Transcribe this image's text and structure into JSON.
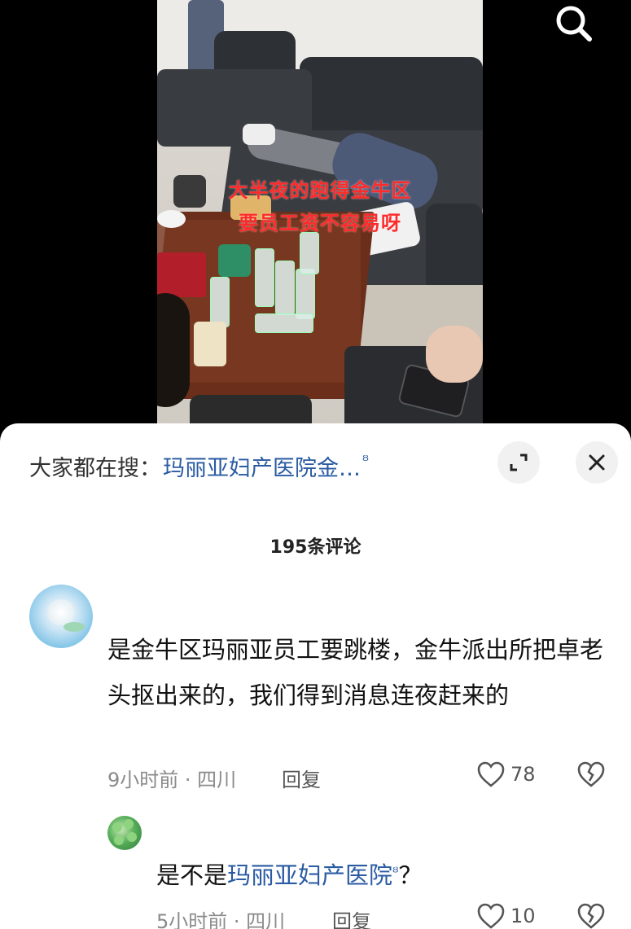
{
  "video": {
    "overlay_line1": "大半夜的跑得金牛区",
    "overlay_line2": "要员工资不容易呀"
  },
  "icons": {
    "search": "search-icon",
    "expand": "expand-icon",
    "close": "close-icon",
    "heart": "heart-icon",
    "dislike": "broken-heart-icon"
  },
  "colors": {
    "link": "#2a5ba3",
    "overlay_text": "#ff2a2a"
  },
  "search_bar": {
    "label": "大家都在搜：",
    "keyword": "玛丽亚妇产医院金…",
    "keyword_icon": "ᴽ"
  },
  "comments_header": {
    "count_label": "195条评论"
  },
  "comments": [
    {
      "text": "是金牛区玛丽亚员工要跳楼，金牛派出所把卓老头抠出来的，我们得到消息连夜赶来的",
      "meta": "9小时前 · 四川",
      "reply_label": "回复",
      "likes": "78"
    },
    {
      "text_prefix": "是不是",
      "text_keyword": "玛丽亚妇产医院",
      "text_suffix": "？",
      "meta": "5小时前 · 四川",
      "reply_label": "回复",
      "likes": "10"
    }
  ]
}
